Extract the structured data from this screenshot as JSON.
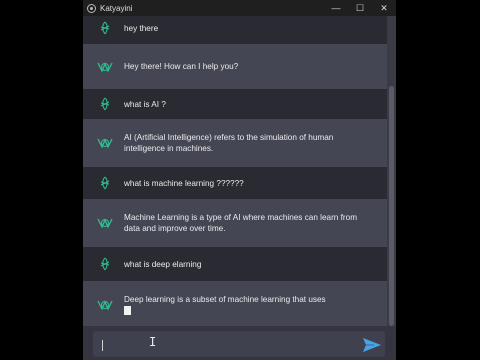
{
  "window": {
    "title": "Katyayini",
    "minimize": "—",
    "maximize": "☐",
    "close": "✕"
  },
  "messages": [
    {
      "role": "user",
      "text": "hey there"
    },
    {
      "role": "bot",
      "text": "Hey there! How can I help you?"
    },
    {
      "role": "user",
      "text": "what is AI ?"
    },
    {
      "role": "bot",
      "text": "AI (Artificial Intelligence) refers to the simulation of human intelligence in machines."
    },
    {
      "role": "user",
      "text": "what is machine learning ??????"
    },
    {
      "role": "bot",
      "text": "Machine Learning is a type of AI where machines can learn from data and improve over time."
    },
    {
      "role": "user",
      "text": "what is deep elarning"
    },
    {
      "role": "bot",
      "text": "Deep learning is a subset of machine learning that uses"
    }
  ],
  "input": {
    "value": "",
    "ibeam": "I"
  },
  "colors": {
    "user_bg": "#2a2b32",
    "bot_bg": "#444654",
    "accent": "#4aa3e0",
    "avatar_green": "#2fbf8f"
  },
  "icons": {
    "user_avatar": "user-avatar-icon",
    "bot_avatar": "bot-logo-icon",
    "send": "send-icon"
  }
}
